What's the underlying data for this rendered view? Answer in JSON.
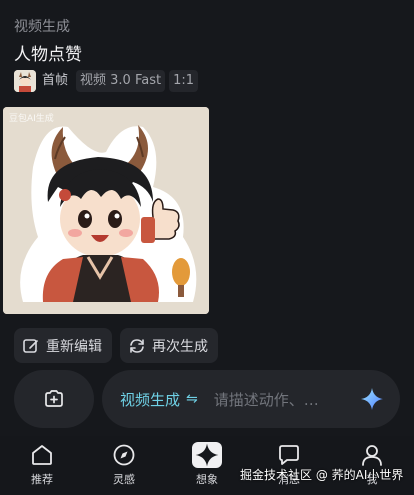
{
  "header": {
    "section_label": "视频生成",
    "prompt_title": "人物点赞"
  },
  "meta": {
    "first_frame_label": "首帧",
    "model": "视频 3.0 Fast",
    "ratio": "1:1"
  },
  "preview": {
    "watermark": "豆包AI生成"
  },
  "actions": {
    "reedit_label": "重新编辑",
    "regenerate_label": "再次生成"
  },
  "composer": {
    "mode_label": "视频生成",
    "mode_switch_glyph": "⇋",
    "placeholder": "请描述动作、…"
  },
  "nav": {
    "items": [
      {
        "label": "推荐",
        "icon": "home-icon"
      },
      {
        "label": "灵感",
        "icon": "compass-icon"
      },
      {
        "label": "想象",
        "icon": "sparkle-icon"
      },
      {
        "label": "消息",
        "icon": "chat-icon"
      },
      {
        "label": "我",
        "icon": "person-icon"
      }
    ]
  },
  "overlay_watermark": "掘金技术社区 @ 荞的AI小世界",
  "colors": {
    "background": "#16181c",
    "accent": "#6fd1e6",
    "surface": "#24262b"
  }
}
